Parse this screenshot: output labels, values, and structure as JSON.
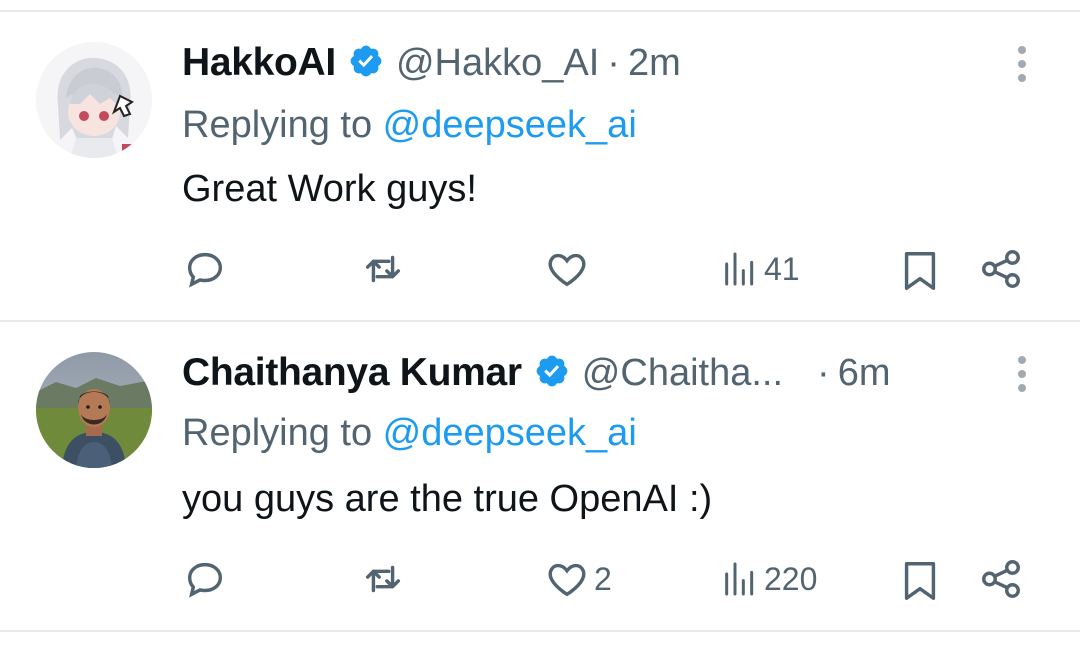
{
  "tweets": [
    {
      "name": "HakkoAI",
      "handle": "@Hakko_AI",
      "separator": "·",
      "time": "2m",
      "replying_prefix": "Replying to ",
      "replying_to": "@deepseek_ai",
      "text": "Great Work guys!",
      "like_count": "",
      "view_count": "41"
    },
    {
      "name": "Chaithanya Kumar",
      "handle": "@Chaitha...",
      "separator": "·",
      "time": "6m",
      "replying_prefix": "Replying to ",
      "replying_to": "@deepseek_ai",
      "text": "you guys are the true OpenAI :)",
      "like_count": "2",
      "view_count": "220"
    }
  ],
  "colors": {
    "text": "#0f1419",
    "muted": "#536471",
    "accent": "#1d9bf0",
    "divider": "#e6e9eb"
  },
  "icons": [
    "verified-badge-icon",
    "more-vertical-icon",
    "reply-icon",
    "retweet-icon",
    "like-icon",
    "views-icon",
    "bookmark-icon",
    "share-icon"
  ]
}
